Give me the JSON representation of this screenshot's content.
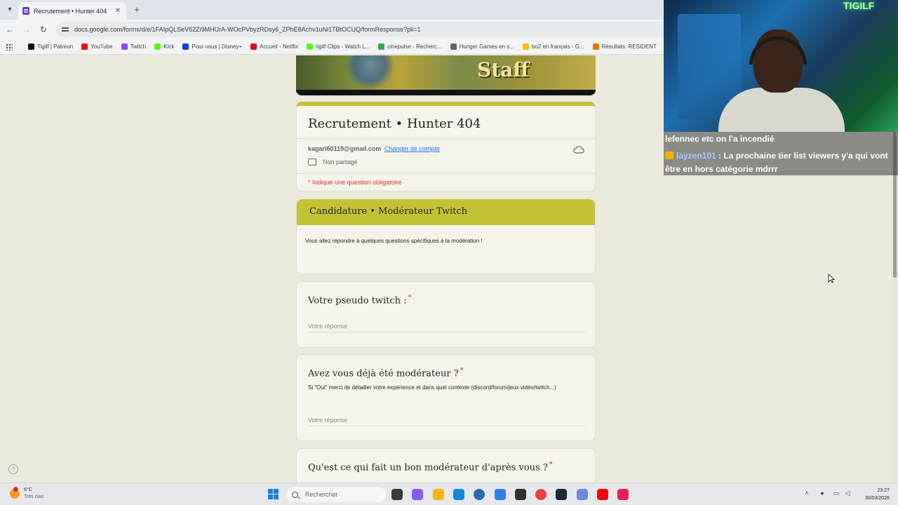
{
  "browser": {
    "tab_title": "Recrutement • Hunter 404",
    "url": "docs.google.com/forms/d/e/1FAIpQLSeV62Zi9MHUrA-WOcPVbyzRDsy6_ZPhE8Achv1uNi1TBtOCUQ/formResponse?pli=1",
    "bookmarks": [
      {
        "label": "Tigilf | Patreon",
        "color": "#111111"
      },
      {
        "label": "YouTube",
        "color": "#ff0000"
      },
      {
        "label": "Twitch",
        "color": "#9146ff"
      },
      {
        "label": "Kick",
        "color": "#53fc18"
      },
      {
        "label": "Pour vous | Disney+",
        "color": "#113ccf"
      },
      {
        "label": "Accueil - Netflix",
        "color": "#e50914"
      },
      {
        "label": "tigilf Clips - Watch L...",
        "color": "#53fc18"
      },
      {
        "label": "cinepulse - Recherc...",
        "color": "#34a853"
      },
      {
        "label": "Hunger Games en s...",
        "color": "#5f6368"
      },
      {
        "label": "bo2 en français - G...",
        "color": "#fbbc04"
      },
      {
        "label": "Résultats: RESIDENT",
        "color": "#e8710a"
      }
    ]
  },
  "form": {
    "banner_text": "Staff",
    "title": "Recrutement • Hunter 404",
    "email": "kagari60119@gmail.com",
    "switch_account": "Changer de compte",
    "not_shared": "Non partagé",
    "required_note": "* Indique une question obligatoire",
    "section_title": "Candidature • Modérateur Twitch",
    "section_desc": "Vous allez répondre à quelques questions spécifiques à la modération !",
    "answer_placeholder": "Votre réponse",
    "required_mark": "*",
    "questions": [
      {
        "title": "Votre pseudo twitch :",
        "help": ""
      },
      {
        "title": "Avez vous déjà été modérateur ?",
        "help": "Si \"Oui\" merci de détailler votre expérience et dans quel contexte (discord/forum/jeux vidéo/twitch...)"
      },
      {
        "title": "Qu'est ce qui fait un bon modérateur d'après vous ?",
        "help": ""
      }
    ],
    "accent_color": "#c4c336",
    "required_color": "#d93025"
  },
  "overlay": {
    "neon_sign": "TIGILF",
    "chat_line1": "lefennec etc on l'a incendié",
    "chat_user": "layzen101",
    "chat_message": " : La prochaine tier list viewers y'a qui vont être en hors catégorie mdrrr"
  },
  "taskbar": {
    "weather_temp": "6°C",
    "weather_cond": "Très clair",
    "search_placeholder": "Rechercher",
    "time": "23:27",
    "date": "30/03/2026",
    "apps": [
      "file-explorer-app",
      "copilot-app",
      "folder-app",
      "edge-app",
      "store-app",
      "vscode-app",
      "obs-app",
      "chrome-app",
      "steam-app",
      "discord-app",
      "youtube-app",
      "tiktok-app"
    ]
  }
}
